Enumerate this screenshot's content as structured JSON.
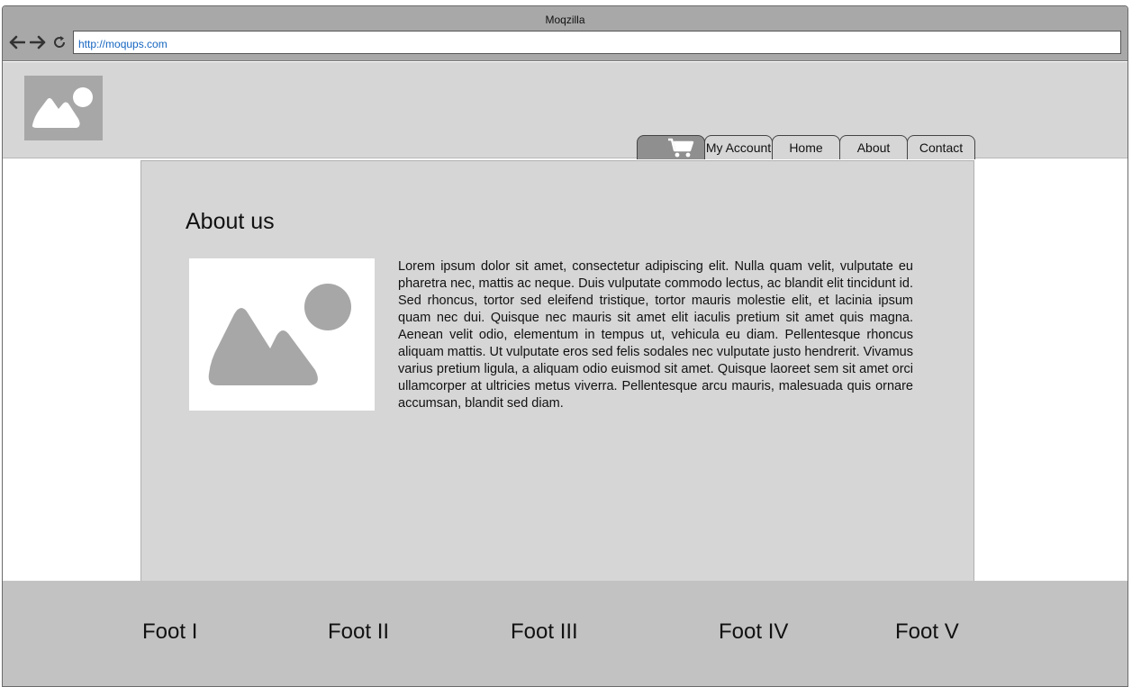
{
  "browser": {
    "window_title": "Moqzilla",
    "url": "http://moqups.com",
    "nav_icons": [
      "back-arrow-icon",
      "forward-arrow-icon",
      "reload-icon"
    ]
  },
  "header": {
    "logo_icon": "image-placeholder-icon",
    "nav_tabs": [
      {
        "label": "",
        "icon": "shopping-cart-icon"
      },
      {
        "label": "My Account"
      },
      {
        "label": "Home"
      },
      {
        "label": "About"
      },
      {
        "label": "Contact"
      }
    ]
  },
  "main": {
    "title": "About us",
    "image_icon": "image-placeholder-icon",
    "paragraph": "Lorem ipsum dolor sit amet, consectetur adipiscing elit. Nulla quam velit, vulputate eu pharetra nec, mattis ac neque. Duis vulputate commodo lectus, ac blandit elit tincidunt id. Sed rhoncus, tortor sed eleifend tristique, tortor mauris molestie elit, et lacinia ipsum quam nec dui. Quisque nec mauris sit amet elit iaculis pretium sit amet quis magna. Aenean velit odio, elementum in tempus ut, vehicula eu diam. Pellentesque rhoncus aliquam mattis. Ut vulputate eros sed felis sodales nec vulputate justo hendrerit. Vivamus varius pretium ligula, a aliquam odio euismod sit amet. Quisque laoreet sem sit amet orci ullamcorper at ultricies metus viverra. Pellentesque arcu mauris, malesuada quis ornare accumsan, blandit sed diam."
  },
  "footer": {
    "items": [
      "Foot I",
      "Foot II",
      "Foot III",
      "Foot IV",
      "Foot V"
    ]
  },
  "colors": {
    "chrome": "#a8a8a8",
    "header_bg": "#d6d6d6",
    "content_bg": "#d6d6d6",
    "footer_bg": "#c2c2c2",
    "url_text": "#1565c0"
  }
}
